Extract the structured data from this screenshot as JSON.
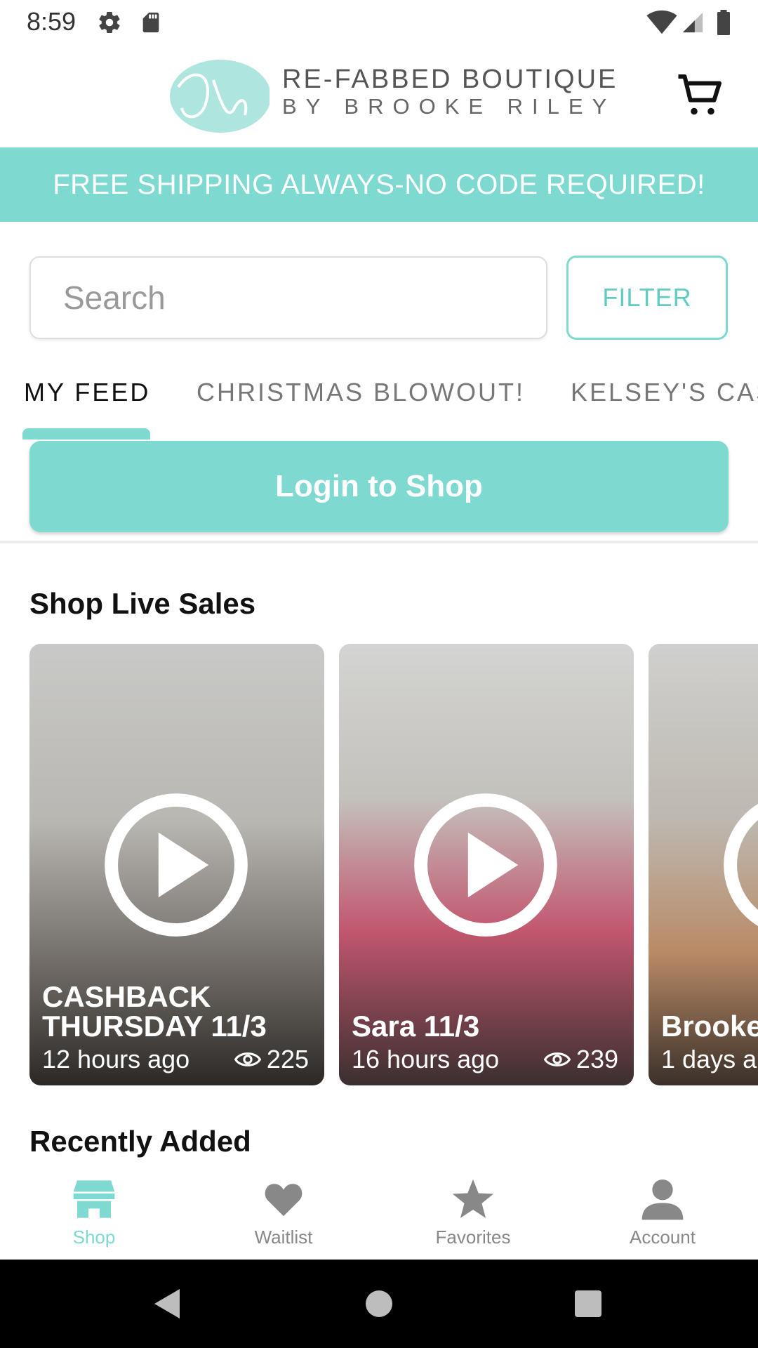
{
  "status": {
    "time": "8:59"
  },
  "header": {
    "brand_line1": "RE-FABBED BOUTIQUE",
    "brand_line2": "BY BROOKE RILEY"
  },
  "promo": {
    "text": "FREE SHIPPING ALWAYS-NO CODE REQUIRED!"
  },
  "search": {
    "placeholder": "Search",
    "value": ""
  },
  "filter": {
    "label": "FILTER"
  },
  "tabs": [
    {
      "label": "MY FEED",
      "active": true
    },
    {
      "label": "CHRISTMAS BLOWOUT!",
      "active": false
    },
    {
      "label": "KELSEY'S CAS",
      "active": false
    }
  ],
  "login": {
    "label": "Login to Shop"
  },
  "live_sales": {
    "title": "Shop Live Sales",
    "items": [
      {
        "title_line1": "CASHBACK",
        "title_line2": "THURSDAY 11/3",
        "time": "12 hours ago",
        "views": "225"
      },
      {
        "title_line1": "",
        "title_line2": "Sara 11/3",
        "time": "16 hours ago",
        "views": "239"
      },
      {
        "title_line1": "",
        "title_line2": "Brooke",
        "time": "1 days a",
        "views": ""
      }
    ]
  },
  "recently_added": {
    "title": "Recently Added"
  },
  "bottom_nav": [
    {
      "label": "Shop",
      "icon": "store-icon",
      "active": true
    },
    {
      "label": "Waitlist",
      "icon": "heart-icon",
      "active": false
    },
    {
      "label": "Favorites",
      "icon": "star-icon",
      "active": false
    },
    {
      "label": "Account",
      "icon": "person-icon",
      "active": false
    }
  ],
  "colors": {
    "accent": "#7ed9d0",
    "nav_inactive": "#888888"
  }
}
